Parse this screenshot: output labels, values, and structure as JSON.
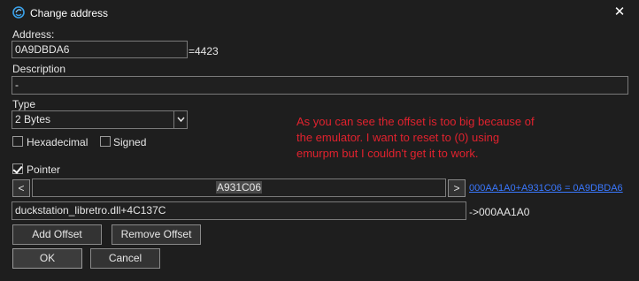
{
  "window": {
    "title": "Change address",
    "close_glyph": "✕",
    "icon": "cheat-engine-icon"
  },
  "address": {
    "label": "Address:",
    "value": "0A9DBDA6",
    "suffix": "=4423"
  },
  "description": {
    "label": "Description",
    "value": "-"
  },
  "type": {
    "label": "Type",
    "selected": "2 Bytes",
    "arrow_glyph": "⌄"
  },
  "options": {
    "hexadecimal": {
      "label": "Hexadecimal",
      "checked": false
    },
    "signed": {
      "label": "Signed",
      "checked": false
    },
    "pointer": {
      "label": "Pointer",
      "checked": true
    }
  },
  "note": {
    "line1": "As you can see the offset is too big because of",
    "line2": "the emulator. I want to reset to (0) using",
    "line3": "emurpm but I couldn't get it to work."
  },
  "pointer": {
    "prev_label": "<",
    "next_label": ">",
    "offset_value": "A931C06",
    "calc_link": "000AA1A0+A931C06 = 0A9DBDA6",
    "base_value": "duckstation_libretro.dll+4C137C",
    "base_result": "->000AA1A0"
  },
  "buttons": {
    "add_offset": "Add Offset",
    "remove_offset": "Remove Offset",
    "ok": "OK",
    "cancel": "Cancel"
  },
  "colors": {
    "background": "#1e1e1e",
    "note_text": "#e0222e",
    "link": "#3a78ff"
  }
}
